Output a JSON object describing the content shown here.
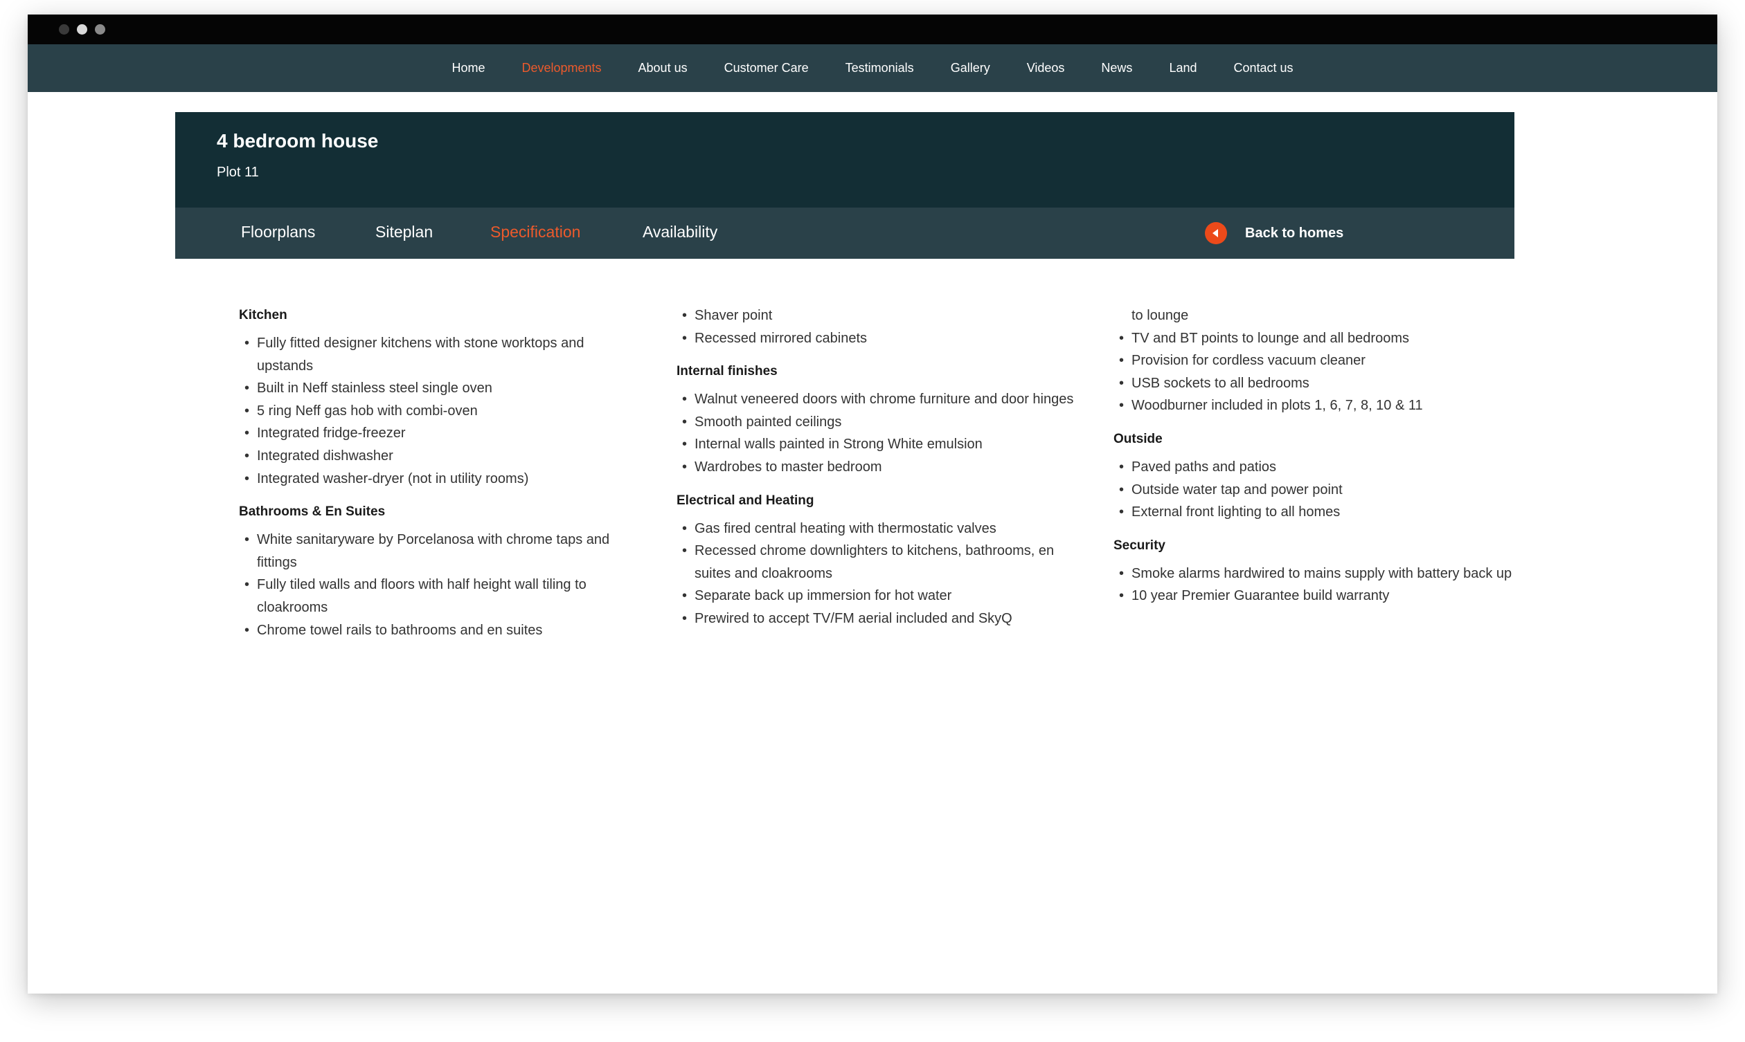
{
  "nav": {
    "items": [
      "Home",
      "Developments",
      "About us",
      "Customer Care",
      "Testimonials",
      "Gallery",
      "Videos",
      "News",
      "Land",
      "Contact us"
    ],
    "active": "Developments"
  },
  "header": {
    "title": "4 bedroom house",
    "subtitle": "Plot 11"
  },
  "tabs": {
    "items": [
      "Floorplans",
      "Siteplan",
      "Specification",
      "Availability"
    ],
    "active": "Specification",
    "back_label": "Back to homes"
  },
  "colors": {
    "accent": "#ec5a2c",
    "nav_bg": "#2a4149",
    "header_bg": "#132e35"
  },
  "specification": {
    "kitchen": {
      "heading": "Kitchen",
      "items": [
        "Fully fitted designer kitchens with stone worktops and upstands",
        "Built in Neff stainless steel single oven",
        "5 ring Neff gas hob with combi-oven",
        "Integrated fridge-freezer",
        "Integrated dishwasher",
        "Integrated washer-dryer (not in utility rooms)"
      ]
    },
    "bathrooms": {
      "heading": "Bathrooms & En Suites",
      "items": [
        "White sanitaryware by Porcelanosa with chrome taps and fittings",
        "Fully tiled walls and floors with half height wall tiling to cloakrooms",
        "Chrome towel rails to bathrooms and en suites",
        "Shaver point",
        "Recessed mirrored cabinets"
      ]
    },
    "internal": {
      "heading": "Internal finishes",
      "items": [
        "Walnut veneered doors with chrome furniture and door hinges",
        "Smooth painted ceilings",
        "Internal walls painted in Strong White emulsion",
        "Wardrobes to master bedroom"
      ]
    },
    "electrical": {
      "heading": "Electrical and Heating",
      "items": [
        "Gas fired central heating with thermostatic valves",
        "Recessed chrome downlighters to kitchens, bathrooms, en suites and cloakrooms",
        "Separate back up immersion for hot water",
        "Prewired to accept TV/FM aerial included and SkyQ",
        "to lounge",
        "TV and BT points to lounge and all bedrooms",
        "Provision for cordless vacuum cleaner",
        "USB sockets to all bedrooms",
        "Woodburner included in plots 1, 6, 7, 8, 10 & 11"
      ]
    },
    "outside": {
      "heading": "Outside",
      "items": [
        "Paved paths and patios",
        "Outside water tap and power point",
        "External front lighting to all homes"
      ]
    },
    "security": {
      "heading": "Security",
      "items": [
        "Smoke alarms hardwired to mains supply with battery back up",
        "10 year Premier Guarantee build warranty"
      ]
    }
  }
}
